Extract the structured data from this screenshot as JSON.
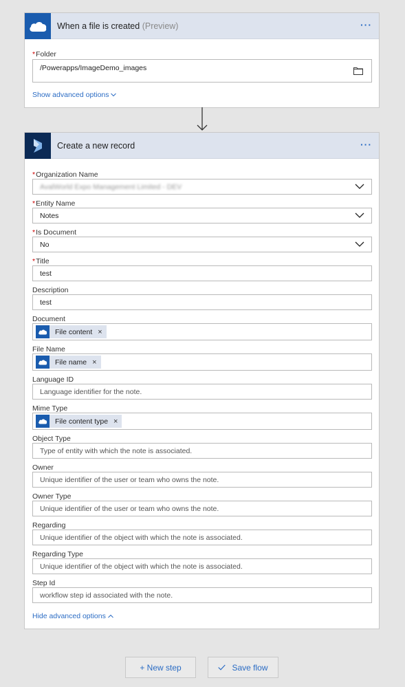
{
  "trigger": {
    "title": "When a file is created",
    "title_suffix": "(Preview)",
    "icon": "onedrive-cloud-icon",
    "folder_label": "Folder",
    "folder_value": "/Powerapps/ImageDemo_images",
    "advanced_link": "Show advanced options"
  },
  "action": {
    "title": "Create a new record",
    "icon": "dynamics-icon",
    "fields": {
      "org_label": "Organization Name",
      "org_value": "AvalWorld Expo Management Limited - DEV",
      "entity_label": "Entity Name",
      "entity_value": "Notes",
      "isdoc_label": "Is Document",
      "isdoc_value": "No",
      "title_label": "Title",
      "title_value": "test",
      "desc_label": "Description",
      "desc_value": "test",
      "doc_label": "Document",
      "doc_token": "File content",
      "filename_label": "File Name",
      "filename_token": "File name",
      "lang_label": "Language ID",
      "lang_placeholder": "Language identifier for the note.",
      "mime_label": "Mime Type",
      "mime_token": "File content type",
      "objtype_label": "Object Type",
      "objtype_placeholder": "Type of entity with which the note is associated.",
      "owner_label": "Owner",
      "owner_placeholder": "Unique identifier of the user or team who owns the note.",
      "ownertype_label": "Owner Type",
      "ownertype_placeholder": "Unique identifier of the user or team who owns the note.",
      "regarding_label": "Regarding",
      "regarding_placeholder": "Unique identifier of the object with which the note is associated.",
      "regtype_label": "Regarding Type",
      "regtype_placeholder": "Unique identifier of the object with which the note is associated.",
      "step_label": "Step Id",
      "step_placeholder": "workflow step id associated with the note."
    },
    "advanced_link": "Hide advanced options"
  },
  "footer": {
    "new_step": "+ New step",
    "save_flow": "Save flow"
  },
  "colors": {
    "accent": "#2b6cc4",
    "onedrive": "#1a5cae",
    "dynamics": "#0b2a55",
    "header_bg": "#dde3ee",
    "required": "#cc0000"
  }
}
